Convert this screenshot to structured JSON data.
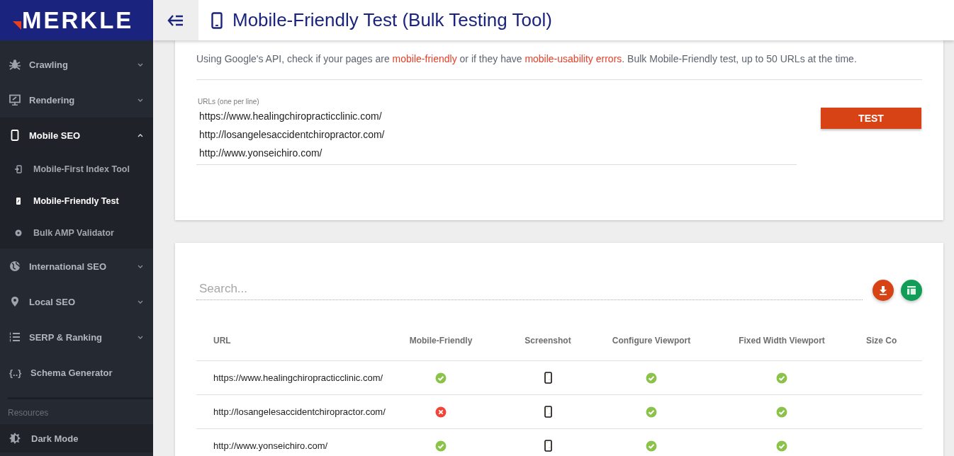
{
  "brand": {
    "logo": "MERKLE"
  },
  "header": {
    "title": "Mobile-Friendly Test (Bulk Testing Tool)"
  },
  "sidebar": {
    "items": [
      {
        "label": "Crawling",
        "kind": "group",
        "expanded": false
      },
      {
        "label": "Rendering",
        "kind": "group",
        "expanded": false
      },
      {
        "label": "Mobile SEO",
        "kind": "group",
        "expanded": true,
        "children": [
          {
            "label": "Mobile-First Index Tool",
            "selected": false
          },
          {
            "label": "Mobile-Friendly Test",
            "selected": true
          },
          {
            "label": "Bulk AMP Validator",
            "selected": false
          }
        ]
      },
      {
        "label": "International SEO",
        "kind": "group",
        "expanded": false
      },
      {
        "label": "Local SEO",
        "kind": "group",
        "expanded": false
      },
      {
        "label": "SERP & Ranking",
        "kind": "group",
        "expanded": false
      },
      {
        "label": "Schema Generator",
        "kind": "link",
        "icon_text": "{..}"
      }
    ],
    "section": "Resources",
    "footer_items": [
      {
        "label": "Dark Mode"
      }
    ]
  },
  "test_form": {
    "description": [
      {
        "text": "Using Google's API, check if your pages are ",
        "kind": "plain"
      },
      {
        "text": "mobile-friendly",
        "kind": "link"
      },
      {
        "text": " or if they have ",
        "kind": "plain"
      },
      {
        "text": "mobile-usability errors",
        "kind": "link"
      },
      {
        "text": ". Bulk Mobile-Friendly test, up to 50 URLs at the time.",
        "kind": "plain"
      }
    ],
    "urls_field": {
      "label": "URLs (one per line)",
      "lines": [
        "https://www.healingchiropracticclinic.com/",
        "http://losangelesaccidentchiropractor.com/",
        "http://www.yonseichiro.com/"
      ]
    },
    "button": "TEST"
  },
  "results": {
    "search": {
      "placeholder": "Search..."
    },
    "table": {
      "columns": [
        "URL",
        "Mobile-Friendly",
        "Screenshot",
        "Configure Viewport",
        "Fixed Width Viewport",
        "Size Co"
      ],
      "rows": [
        {
          "url": "https://www.healingchiropracticclinic.com/",
          "mobile_friendly": true,
          "configure_viewport": true,
          "fixed_width_viewport": true
        },
        {
          "url": "http://losangelesaccidentchiropractor.com/",
          "mobile_friendly": false,
          "configure_viewport": true,
          "fixed_width_viewport": true
        },
        {
          "url": "http://www.yonseichiro.com/",
          "mobile_friendly": true,
          "configure_viewport": true,
          "fixed_width_viewport": true
        }
      ]
    }
  }
}
